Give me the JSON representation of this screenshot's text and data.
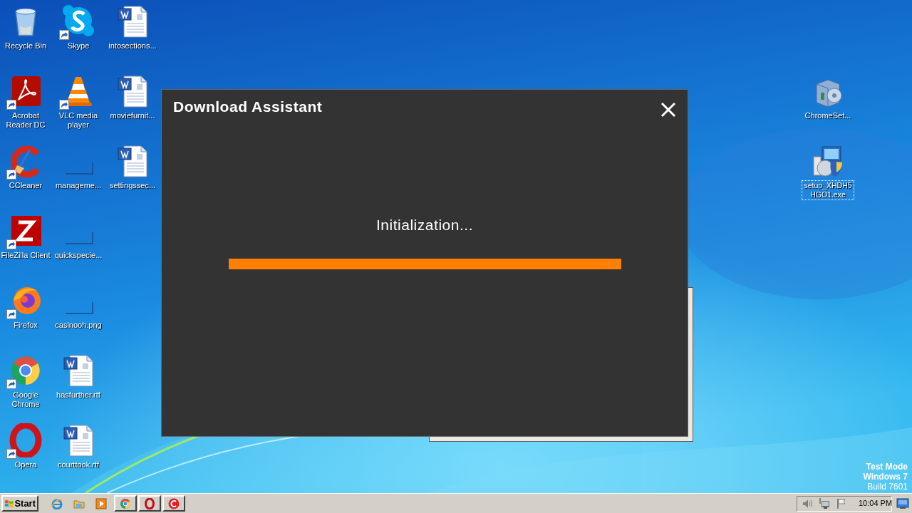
{
  "desktop_columns": [
    {
      "icons": [
        {
          "label": "Recycle Bin",
          "kind": "recycle-bin",
          "shortcut": false,
          "selected": false
        },
        {
          "label": "Acrobat Reader DC",
          "kind": "acrobat",
          "shortcut": true,
          "selected": false
        },
        {
          "label": "CCleaner",
          "kind": "ccleaner",
          "shortcut": true,
          "selected": false
        },
        {
          "label": "FileZilla Client",
          "kind": "filezilla",
          "shortcut": true,
          "selected": false
        },
        {
          "label": "Firefox",
          "kind": "firefox",
          "shortcut": true,
          "selected": false
        },
        {
          "label": "Google Chrome",
          "kind": "chrome",
          "shortcut": true,
          "selected": false
        },
        {
          "label": "Opera",
          "kind": "opera",
          "shortcut": true,
          "selected": false
        }
      ]
    },
    {
      "icons": [
        {
          "label": "Skype",
          "kind": "skype",
          "shortcut": true,
          "selected": false
        },
        {
          "label": "VLC media player",
          "kind": "vlc",
          "shortcut": true,
          "selected": false
        },
        {
          "label": "manageme...",
          "kind": "blank",
          "shortcut": false,
          "selected": false
        },
        {
          "label": "quickspecie...",
          "kind": "blank",
          "shortcut": false,
          "selected": false
        },
        {
          "label": "casinooh.png",
          "kind": "blank",
          "shortcut": false,
          "selected": false
        },
        {
          "label": "hasfurther.rtf",
          "kind": "word",
          "shortcut": false,
          "selected": false
        },
        {
          "label": "courttook.rtf",
          "kind": "word",
          "shortcut": false,
          "selected": false
        }
      ]
    },
    {
      "icons": [
        {
          "label": "intosections...",
          "kind": "word",
          "shortcut": false,
          "selected": false
        },
        {
          "label": "moviefurnit...",
          "kind": "word",
          "shortcut": false,
          "selected": false
        },
        {
          "label": "settingssec...",
          "kind": "word",
          "shortcut": false,
          "selected": false
        }
      ]
    }
  ],
  "right_icons": [
    {
      "label": "ChromeSet...",
      "kind": "installer-box",
      "shortcut": false,
      "selected": false
    },
    {
      "label": "setup_XHDH5HGO1.exe",
      "kind": "setup",
      "shortcut": false,
      "selected": true
    }
  ],
  "dialog": {
    "title": "Download Assistant",
    "status": "Initialization..."
  },
  "os_notice": {
    "lines": [
      "Test Mode",
      "Windows 7",
      "Build 7601"
    ]
  },
  "taskbar": {
    "start_button": {
      "label": "Start"
    },
    "quick_launch": [
      {
        "kind": "ie"
      },
      {
        "kind": "folder"
      },
      {
        "kind": "media"
      }
    ],
    "task_buttons": [
      {
        "kind": "chrome"
      },
      {
        "kind": "opera"
      },
      {
        "kind": "red-c"
      }
    ],
    "tray_icons": [
      {
        "kind": "speaker"
      },
      {
        "kind": "network"
      },
      {
        "kind": "flag"
      }
    ],
    "clock": "10:04 PM"
  }
}
